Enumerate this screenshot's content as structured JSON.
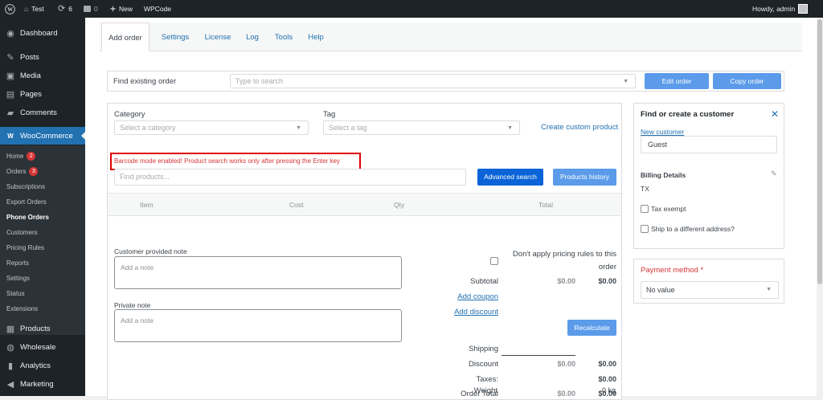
{
  "adminbar": {
    "site": "Test",
    "updates": "6",
    "comments": "0",
    "new": "New",
    "wpcode": "WPCode",
    "howdy": "Howdy, admin"
  },
  "sidebar": {
    "dashboard": "Dashboard",
    "posts": "Posts",
    "media": "Media",
    "pages": "Pages",
    "comments": "Comments",
    "woocommerce": "WooCommerce",
    "subs": [
      "Home",
      "Orders",
      "Subscriptions",
      "Export Orders",
      "Phone Orders",
      "Customers",
      "Pricing Rules",
      "Reports",
      "Settings",
      "Status",
      "Extensions"
    ],
    "home_badge": "2",
    "orders_badge": "3",
    "products": "Products",
    "wholesale": "Wholesale",
    "analytics": "Analytics",
    "marketing": "Marketing"
  },
  "tabs": [
    "Add order",
    "Settings",
    "License",
    "Log",
    "Tools",
    "Help"
  ],
  "find": {
    "label": "Find existing order",
    "placeholder": "Type to search",
    "edit": "Edit order",
    "copy": "Copy order"
  },
  "products": {
    "category_label": "Category",
    "category_ph": "Select a category",
    "tag_label": "Tag",
    "tag_ph": "Select a tag",
    "create_custom": "Create custom product",
    "barcode_msg": "Barcode mode enabled! Product search works only after pressing the Enter key",
    "search_ph": "Find products...",
    "advanced": "Advanced search",
    "history": "Products history",
    "cols": [
      "Item",
      "Cost",
      "Qty",
      "Total"
    ]
  },
  "notes": {
    "customer_label": "Customer provided note",
    "customer_ph": "Add a note",
    "private_label": "Private note",
    "private_ph": "Add a note"
  },
  "totals": {
    "dont_apply": "Don't apply pricing rules to this order",
    "subtotal": "Subtotal",
    "subtotal_v1": "$0.00",
    "subtotal_v2": "$0.00",
    "add_coupon": "Add coupon",
    "add_discount": "Add discount",
    "recalc": "Recalculate",
    "shipping": "Shipping",
    "discount": "Discount",
    "discount_v1": "$0.00",
    "discount_v2": "$0.00",
    "taxes": "Taxes:",
    "taxes_v": "$0.00",
    "order_total": "Order Total",
    "order_total_v1": "$0.00",
    "order_total_v2": "$0.00",
    "weight": "Weight",
    "weight_v": "0 kg"
  },
  "customer": {
    "title": "Find or create a customer",
    "new": "New customer",
    "value": "Guest",
    "billing": "Billing Details",
    "billing_state": "TX",
    "tax_exempt": "Tax exempt",
    "ship_diff": "Ship to a different address?"
  },
  "payment": {
    "title": "Payment method",
    "required": "*",
    "value": "No value"
  },
  "colors": {
    "accent": "#2271b1",
    "woo": "#2271b1",
    "error": "#d63638",
    "btn_primary": "#0a64d8",
    "btn_light": "#5b9bea"
  }
}
